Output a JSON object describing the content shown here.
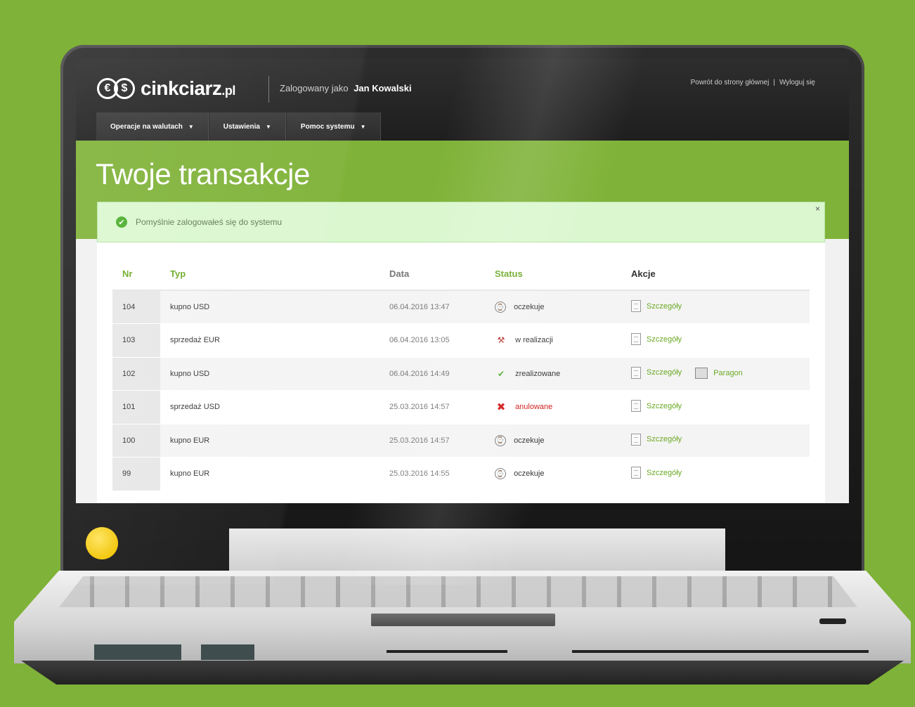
{
  "header": {
    "logo_text": "cinkciarz",
    "logo_suffix": ".pl",
    "logo_mark": [
      "€",
      "$"
    ],
    "logged_in_label": "Zalogowany jako",
    "user_name": "Jan Kowalski",
    "top_links": [
      "Powrót do strony głównej",
      "|",
      "Wyloguj się"
    ]
  },
  "nav": {
    "items": [
      {
        "label": "Operacje na walutach"
      },
      {
        "label": "Ustawienia"
      },
      {
        "label": "Pomoc systemu"
      }
    ],
    "caret": "▼"
  },
  "page": {
    "title": "Twoje transakcje"
  },
  "alert": {
    "text": "Pomyślnie zalogowałeś się do systemu",
    "icon": "check-icon",
    "close": "×"
  },
  "table": {
    "headers": {
      "nr": "Nr",
      "typ": "Typ",
      "data": "Data",
      "status": "Status",
      "akcje": "Akcje"
    },
    "rows": [
      {
        "nr": "104",
        "typ": "kupno USD",
        "data": "06.04.2016 13:47",
        "status": "oczekuje",
        "status_icon": "clock-icon",
        "actions": [
          "Szczegóły"
        ]
      },
      {
        "nr": "103",
        "typ": "sprzedaż EUR",
        "data": "06.04.2016 13:05",
        "status": "w realizacji",
        "status_icon": "processing-icon",
        "actions": [
          "Szczegóły"
        ]
      },
      {
        "nr": "102",
        "typ": "kupno USD",
        "data": "06.04.2016 14:49",
        "status": "zrealizowane",
        "status_icon": "check-icon",
        "actions": [
          "Szczegóły",
          "Paragon"
        ]
      },
      {
        "nr": "101",
        "typ": "sprzedaż USD",
        "data": "25.03.2016 14:57",
        "status": "anulowane",
        "status_icon": "cancel-icon",
        "actions": [
          "Szczegóły"
        ]
      },
      {
        "nr": "100",
        "typ": "kupno EUR",
        "data": "25.03.2016 14:57",
        "status": "oczekuje",
        "status_icon": "clock-icon",
        "actions": [
          "Szczegóły"
        ]
      },
      {
        "nr": "99",
        "typ": "kupno EUR",
        "data": "25.03.2016 14:55",
        "status": "oczekuje",
        "status_icon": "clock-icon",
        "actions": [
          "Szczegóły"
        ]
      }
    ]
  },
  "colors": {
    "brand_green": "#7fb238",
    "link_green": "#6aa923",
    "alert_bg": "#daf7cf",
    "cancel_red": "#d21a1a",
    "power_led": "#f2c500"
  }
}
